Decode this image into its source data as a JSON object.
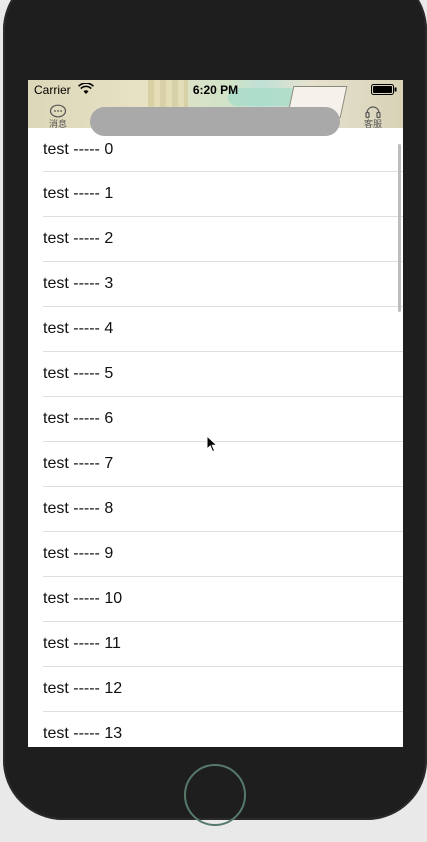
{
  "status_bar": {
    "carrier": "Carrier",
    "time": "6:20 PM"
  },
  "nav": {
    "left_label": "消息",
    "right_label": "客服"
  },
  "list": {
    "items": [
      "test ----- 0",
      "test ----- 1",
      "test ----- 2",
      "test ----- 3",
      "test ----- 4",
      "test ----- 5",
      "test ----- 6",
      "test ----- 7",
      "test ----- 8",
      "test ----- 9",
      "test ----- 10",
      "test ----- 11",
      "test ----- 12",
      "test ----- 13"
    ]
  },
  "icons": {
    "left": "message-icon",
    "right": "headset-icon",
    "wifi": "wifi-icon",
    "battery": "battery-icon",
    "cursor": "cursor-icon"
  },
  "colors": {
    "search_pill": "#a9a9a9",
    "device_body": "#1e1e1e",
    "home_ring": "#567a6a",
    "separator": "#dedede"
  }
}
